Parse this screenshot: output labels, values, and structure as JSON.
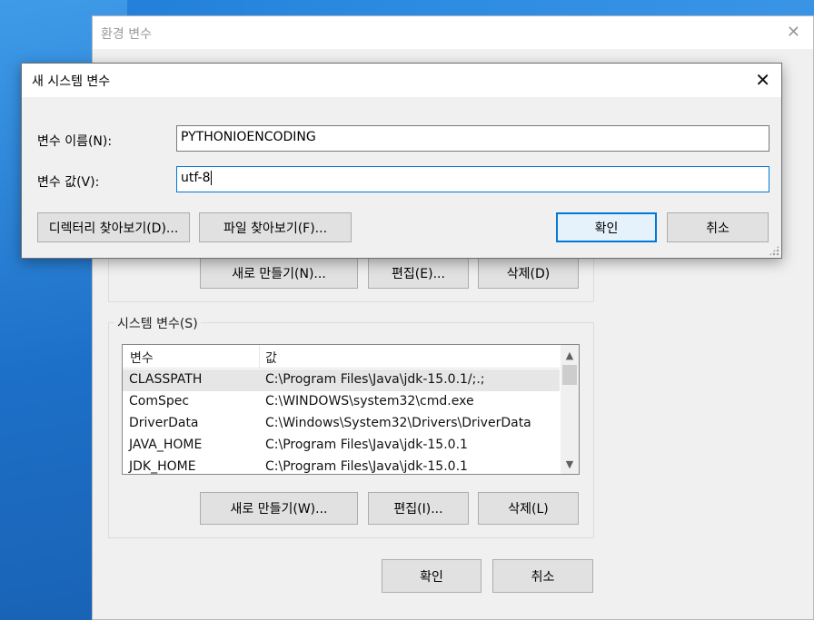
{
  "env_window": {
    "title": "환경 변수",
    "user_buttons": {
      "new": "새로 만들기(N)...",
      "edit": "편집(E)...",
      "delete": "삭제(D)"
    },
    "system_group_label": "시스템 변수(S)",
    "system_list": {
      "columns": [
        "변수",
        "값"
      ],
      "rows": [
        {
          "name": "CLASSPATH",
          "value": "C:\\Program Files\\Java\\jdk-15.0.1/;.;"
        },
        {
          "name": "ComSpec",
          "value": "C:\\WINDOWS\\system32\\cmd.exe"
        },
        {
          "name": "DriverData",
          "value": "C:\\Windows\\System32\\Drivers\\DriverData"
        },
        {
          "name": "JAVA_HOME",
          "value": "C:\\Program Files\\Java\\jdk-15.0.1"
        },
        {
          "name": "JDK_HOME",
          "value": "C:\\Program Files\\Java\\jdk-15.0.1"
        }
      ]
    },
    "system_buttons": {
      "new": "새로 만들기(W)...",
      "edit": "편집(I)...",
      "delete": "삭제(L)"
    },
    "ok": "확인",
    "cancel": "취소"
  },
  "dialog": {
    "title": "새 시스템 변수",
    "name_label": "변수 이름(N):",
    "name_value": "PYTHONIOENCODING",
    "value_label": "변수 값(V):",
    "value_value": "utf-8",
    "browse_dir": "디렉터리 찾아보기(D)...",
    "browse_file": "파일 찾아보기(F)...",
    "ok": "확인",
    "cancel": "취소"
  }
}
